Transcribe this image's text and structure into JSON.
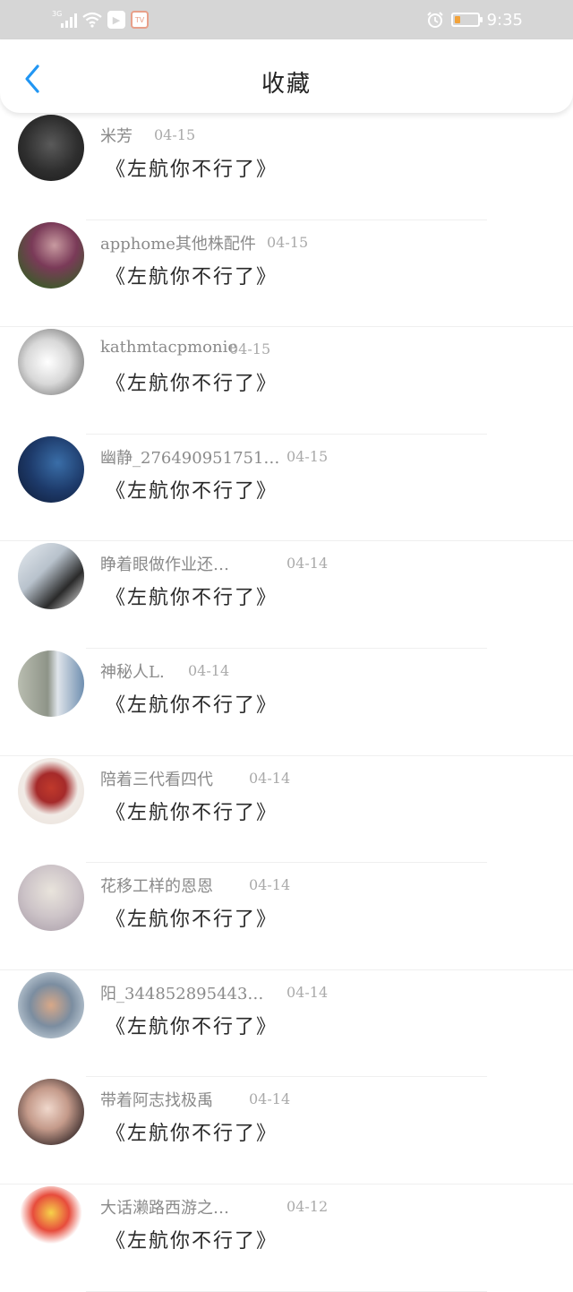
{
  "status_bar": {
    "network": "3G",
    "time": "9:35",
    "app_badge": "TV"
  },
  "header": {
    "title": "收藏"
  },
  "icons": {
    "back": "chevron-left-icon",
    "alarm": "alarm-clock-icon",
    "battery": "battery-low-icon",
    "wifi": "wifi-icon",
    "signal": "signal-icon"
  },
  "colors": {
    "back_arrow": "#2196f3",
    "status_bar": "#d6d6d6",
    "battery_fill": "#f2a23a"
  },
  "items": [
    {
      "name": "米芳",
      "date": "04-15",
      "message": "《左航你不行了》"
    },
    {
      "name": "apphome其他株配件",
      "date": "04-15",
      "message": "《左航你不行了》"
    },
    {
      "name": "kathmtacpmonie",
      "date": "04-15",
      "message": "《左航你不行了》"
    },
    {
      "name": "幽静_276490951751…",
      "date": "04-15",
      "message": "《左航你不行了》"
    },
    {
      "name": "睁着眼做作业还…",
      "date": "04-14",
      "message": "《左航你不行了》"
    },
    {
      "name": "神秘人L.",
      "date": "04-14",
      "message": "《左航你不行了》"
    },
    {
      "name": "陪着三代看四代",
      "date": "04-14",
      "message": "《左航你不行了》"
    },
    {
      "name": "花移工样的恩恩",
      "date": "04-14",
      "message": "《左航你不行了》"
    },
    {
      "name": "阳_344852895443…",
      "date": "04-14",
      "message": "《左航你不行了》"
    },
    {
      "name": "带着阿志找极禹",
      "date": "04-14",
      "message": "《左航你不行了》"
    },
    {
      "name": "大话濑路西游之…",
      "date": "04-12",
      "message": "《左航你不行了》"
    }
  ]
}
